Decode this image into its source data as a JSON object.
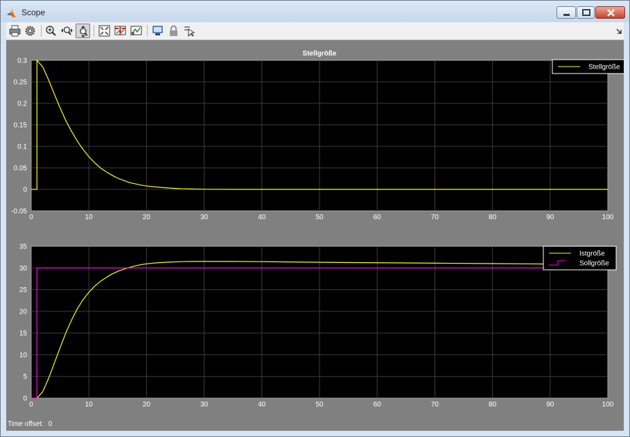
{
  "window": {
    "title": "Scope"
  },
  "toolbar": {
    "buttons": [
      {
        "icon": "print-icon"
      },
      {
        "icon": "settings-gear-icon"
      },
      {
        "icon": "zoom-in-icon"
      },
      {
        "icon": "zoom-x-icon"
      },
      {
        "icon": "zoom-y-icon",
        "active": true
      },
      {
        "icon": "fit-to-view-icon"
      },
      {
        "icon": "triggers-icon"
      },
      {
        "icon": "cursor-measurements-icon"
      },
      {
        "icon": "highlight-simulink-block-icon"
      },
      {
        "icon": "lock-axes-icon"
      },
      {
        "icon": "signal-selection-icon"
      }
    ]
  },
  "status": {
    "time_offset_label": "Time offset:",
    "time_offset_value": "0"
  },
  "colors": {
    "background": "#808080",
    "axes_bg": "#000000",
    "grid": "#3c3c3c",
    "yellow": "#ffff00",
    "magenta": "#ff00ff",
    "text": "#ffffff"
  },
  "chart_data": [
    {
      "type": "line",
      "title": "Stellgröße",
      "xlabel": "",
      "ylabel": "",
      "xlim": [
        0,
        100
      ],
      "ylim": [
        -0.05,
        0.3
      ],
      "xticks": [
        0,
        10,
        20,
        30,
        40,
        50,
        60,
        70,
        80,
        90,
        100
      ],
      "yticks": [
        -0.05,
        0,
        0.05,
        0.1,
        0.15,
        0.2,
        0.25,
        0.3
      ],
      "ytick_labels": [
        "-0.05",
        "0",
        "0.05",
        "0.1",
        "0.15",
        "0.2",
        "0.25",
        "0.3"
      ],
      "grid": true,
      "legend": "top-right",
      "series": [
        {
          "name": "Stellgröße",
          "color": "#ffff00",
          "step": false,
          "x": [
            0,
            1,
            1,
            2,
            3,
            4,
            5,
            6,
            7,
            8,
            9,
            10,
            11,
            12,
            13,
            14,
            15,
            16,
            17,
            18,
            19,
            20,
            22,
            24,
            26,
            28,
            30,
            35,
            40,
            50,
            60,
            70,
            80,
            90,
            100
          ],
          "y": [
            0,
            0,
            0.3,
            0.285,
            0.255,
            0.222,
            0.19,
            0.16,
            0.135,
            0.112,
            0.093,
            0.076,
            0.062,
            0.05,
            0.041,
            0.033,
            0.026,
            0.021,
            0.016,
            0.013,
            0.01,
            0.008,
            0.005,
            0.003,
            0.0015,
            0.0008,
            0.0003,
            0,
            0,
            0,
            0,
            0,
            0,
            0,
            0
          ]
        }
      ]
    },
    {
      "type": "line",
      "title": "",
      "xlabel": "",
      "ylabel": "",
      "xlim": [
        0,
        100
      ],
      "ylim": [
        0,
        35
      ],
      "xticks": [
        0,
        10,
        20,
        30,
        40,
        50,
        60,
        70,
        80,
        90,
        100
      ],
      "yticks": [
        0,
        5,
        10,
        15,
        20,
        25,
        30,
        35
      ],
      "ytick_labels": [
        "0",
        "5",
        "10",
        "15",
        "20",
        "25",
        "30",
        "35"
      ],
      "grid": true,
      "legend": "top-right",
      "series": [
        {
          "name": "Istgröße",
          "color": "#ffff00",
          "step": false,
          "x": [
            0,
            1,
            2,
            3,
            4,
            5,
            6,
            7,
            8,
            9,
            10,
            11,
            12,
            13,
            14,
            15,
            16,
            17,
            18,
            19,
            20,
            22,
            24,
            26,
            28,
            30,
            35,
            40,
            50,
            60,
            70,
            80,
            90,
            100
          ],
          "y": [
            0,
            0,
            1.5,
            4.5,
            8.0,
            11.6,
            15.0,
            18.0,
            20.6,
            22.7,
            24.4,
            25.8,
            26.9,
            27.8,
            28.6,
            29.2,
            29.7,
            30.1,
            30.45,
            30.75,
            30.95,
            31.2,
            31.35,
            31.45,
            31.5,
            31.5,
            31.5,
            31.45,
            31.3,
            31.2,
            31.1,
            31.0,
            30.9,
            30.85
          ]
        },
        {
          "name": "Sollgröße",
          "color": "#ff00ff",
          "step": true,
          "x": [
            0,
            1,
            1,
            100
          ],
          "y": [
            0,
            0,
            30,
            30
          ]
        }
      ]
    }
  ]
}
